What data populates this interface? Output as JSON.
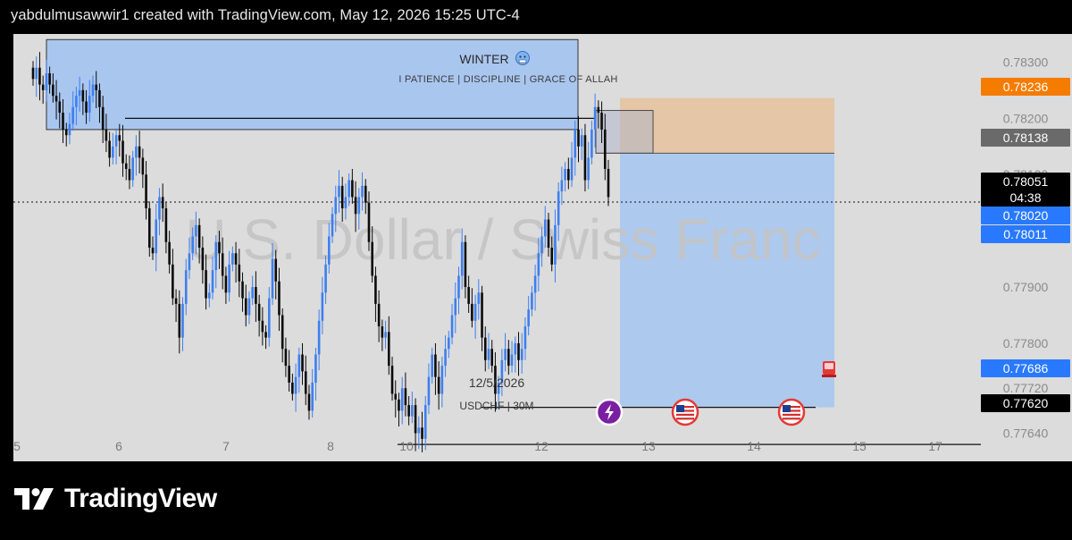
{
  "header": {
    "caption": "yabdulmusawwir1 created with TradingView.com, May 12, 2026 15:25 UTC-4"
  },
  "watermark": "U.S. Dollar / Swiss Franc",
  "annotations": {
    "title": "WINTER",
    "title_icon": "cold-face-emoji",
    "subtitle": "I PATIENCE  |  DISCIPLINE  |  GRACE OF ALLAH",
    "date_label": "12/5/2026",
    "symbol_label": "USDCHF | 30M"
  },
  "event_icons": [
    "lightning-event-icon",
    "us-flag-event-icon",
    "us-flag-event-icon",
    "alarm-event-icon"
  ],
  "footer": {
    "brand": "TradingView"
  },
  "colors": {
    "background": "#000000",
    "chart_bg": "#dcdcdc",
    "candle_up": "#3d7ff0",
    "candle_down": "#0b0b0b",
    "zone_blue": "#a9c6ef",
    "zone_orange": "#e6c3a0",
    "orange_label": "#f57c00",
    "blue_label": "#2979ff",
    "gray_label": "#6a6a6a"
  },
  "chart_data": {
    "type": "candlestick",
    "symbol": "USDCHF",
    "timeframe": "30M",
    "x_ticks": [
      "5",
      "6",
      "7",
      "8",
      "10",
      "12",
      "13",
      "14",
      "15",
      "17"
    ],
    "y_ticks": [
      "0.78300",
      "0.78200",
      "0.78100",
      "0.77900",
      "0.77800",
      "0.77720",
      "0.77640"
    ],
    "price_labels": [
      {
        "value": "0.78236",
        "kind": "orange"
      },
      {
        "value": "0.78138",
        "kind": "gray"
      },
      {
        "value": "0.78051",
        "kind": "black",
        "countdown": "04:38"
      },
      {
        "value": "0.78020",
        "kind": "blue"
      },
      {
        "value": "0.78011",
        "kind": "blue"
      },
      {
        "value": "0.77686",
        "kind": "blue"
      },
      {
        "value": "0.77620",
        "kind": "black"
      }
    ],
    "current_price": 0.78051,
    "horizontal_levels": [
      0.782,
      0.77686,
      0.7762
    ],
    "supply_zone": {
      "top": 0.7834,
      "bottom": 0.7818
    },
    "position": {
      "entry": 0.78138,
      "stop": 0.78236,
      "target": 0.77686,
      "type": "short"
    },
    "y_range": [
      0.7759,
      0.7835
    ],
    "closes": [
      0.7827,
      0.7829,
      0.7826,
      0.7825,
      0.7828,
      0.7826,
      0.7824,
      0.7823,
      0.7821,
      0.7818,
      0.7817,
      0.7819,
      0.7822,
      0.7824,
      0.7825,
      0.7823,
      0.7821,
      0.7824,
      0.7826,
      0.7825,
      0.7822,
      0.7818,
      0.7816,
      0.7813,
      0.7815,
      0.7817,
      0.7816,
      0.7812,
      0.7811,
      0.7809,
      0.7813,
      0.7815,
      0.7813,
      0.781,
      0.7804,
      0.7797,
      0.7796,
      0.7802,
      0.7806,
      0.7804,
      0.7798,
      0.7794,
      0.7788,
      0.7787,
      0.7781,
      0.7787,
      0.7793,
      0.7796,
      0.7799,
      0.7801,
      0.7797,
      0.7793,
      0.7788,
      0.7789,
      0.7793,
      0.7798,
      0.7796,
      0.7792,
      0.7789,
      0.7794,
      0.7796,
      0.7794,
      0.7791,
      0.7788,
      0.7785,
      0.7788,
      0.779,
      0.7787,
      0.7784,
      0.7782,
      0.7781,
      0.7788,
      0.7795,
      0.7791,
      0.7785,
      0.7779,
      0.7776,
      0.7773,
      0.7771,
      0.7774,
      0.7778,
      0.7775,
      0.7771,
      0.7768,
      0.7773,
      0.7778,
      0.7784,
      0.7789,
      0.7794,
      0.7799,
      0.7803,
      0.7806,
      0.7808,
      0.7804,
      0.7806,
      0.7809,
      0.7806,
      0.7803,
      0.7806,
      0.7808,
      0.7805,
      0.7798,
      0.7792,
      0.7787,
      0.7783,
      0.7781,
      0.7782,
      0.7776,
      0.7771,
      0.777,
      0.7768,
      0.7772,
      0.7769,
      0.7767,
      0.7769,
      0.7764,
      0.7765,
      0.7763,
      0.7769,
      0.7774,
      0.7778,
      0.7774,
      0.7771,
      0.7776,
      0.7779,
      0.7781,
      0.7785,
      0.7788,
      0.7792,
      0.7798,
      0.779,
      0.7787,
      0.7784,
      0.7787,
      0.7789,
      0.7781,
      0.7777,
      0.7779,
      0.7776,
      0.7771,
      0.7773,
      0.7777,
      0.7779,
      0.7776,
      0.7778,
      0.778,
      0.7777,
      0.7779,
      0.7783,
      0.7786,
      0.7789,
      0.7792,
      0.7796,
      0.7799,
      0.7802,
      0.7797,
      0.7794,
      0.7801,
      0.7807,
      0.7809,
      0.7811,
      0.7809,
      0.7813,
      0.7818,
      0.7815,
      0.7817,
      0.7809,
      0.7813,
      0.7818,
      0.7822,
      0.7821,
      0.7818,
      0.7811,
      0.7806
    ]
  }
}
